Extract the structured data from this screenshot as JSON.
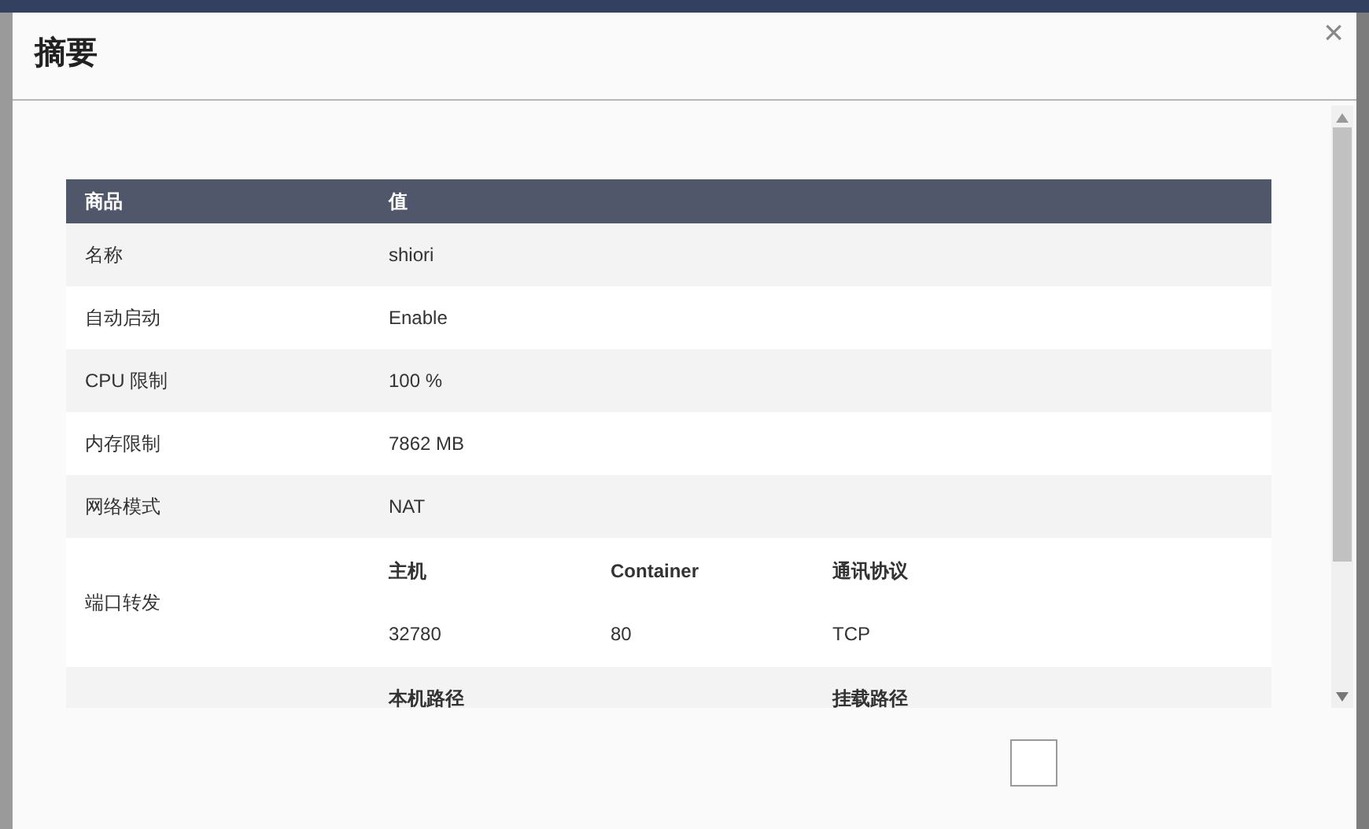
{
  "dialog": {
    "title": "摘要",
    "close": "×"
  },
  "table": {
    "columns": [
      "商品",
      "值"
    ],
    "rows": [
      {
        "kind": "text",
        "label": "名称",
        "value": "shiori"
      },
      {
        "kind": "text",
        "label": "自动启动",
        "value": "Enable"
      },
      {
        "kind": "text",
        "label": "CPU 限制",
        "value": "100 %"
      },
      {
        "kind": "text",
        "label": "内存限制",
        "value": "7862 MB"
      },
      {
        "kind": "text",
        "label": "网络模式",
        "value": "NAT"
      },
      {
        "kind": "ports",
        "label": "端口转发",
        "headers": [
          "主机",
          "Container",
          "通讯协议"
        ],
        "values": [
          "32780",
          "80",
          "TCP"
        ]
      },
      {
        "kind": "volumes",
        "headers": [
          "本机路径",
          "挂载路径"
        ]
      }
    ]
  }
}
